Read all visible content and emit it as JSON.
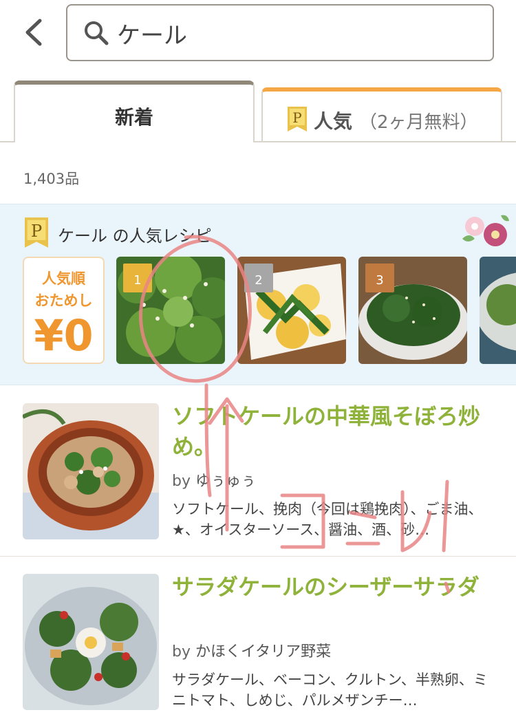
{
  "search": {
    "query": "ケール"
  },
  "tabs": {
    "new_label": "新着",
    "popular_label": "人気",
    "popular_sub": "（2ヶ月無料）"
  },
  "result_count": "1,403品",
  "popular": {
    "title": "ケール の人気レシピ",
    "promo": {
      "line1": "人気順",
      "line2": "おためし",
      "price": "¥0"
    },
    "ranks": [
      "1",
      "2",
      "3"
    ],
    "rank_colors": [
      "#e8b43a",
      "#a6a6a6",
      "#c07a40"
    ]
  },
  "recipes": [
    {
      "title": "ソフトケールの中華風そぼろ炒め。",
      "by": "by",
      "author": "ゆぅゅぅ",
      "ingredients": "ソフトケール、挽肉（今回は鶏挽肉）、ごま油、★、オイスターソース、醤油、酒、砂…"
    },
    {
      "title": "サラダケールのシーザーサラダ",
      "by": "by",
      "author": "かほくイタリア野菜",
      "ingredients": "サラダケール、ベーコン、クルトン、半熟卵、ミニトマト、しめじ、パルメザンチー…"
    }
  ],
  "colors": {
    "title_green": "#8fb23a",
    "accent_orange": "#f0962f",
    "annotation_red": "#e87a7a"
  }
}
